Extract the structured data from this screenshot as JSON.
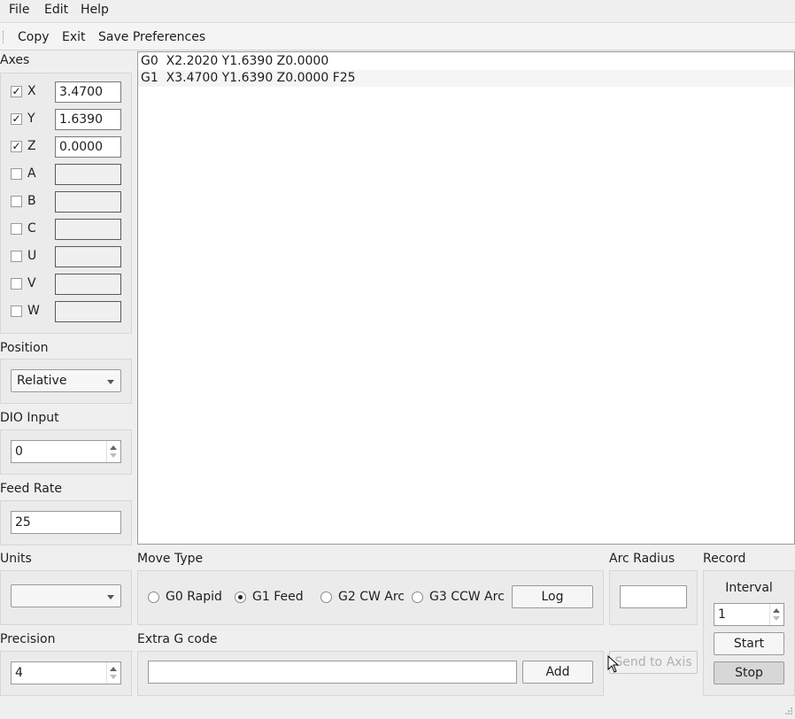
{
  "menu": {
    "file": "File",
    "edit": "Edit",
    "help": "Help"
  },
  "toolbar": {
    "copy": "Copy",
    "exit": "Exit",
    "save_prefs": "Save Preferences"
  },
  "axes": {
    "title": "Axes",
    "items": [
      {
        "label": "X",
        "checked": true,
        "value": "3.4700"
      },
      {
        "label": "Y",
        "checked": true,
        "value": "1.6390"
      },
      {
        "label": "Z",
        "checked": true,
        "value": "0.0000"
      },
      {
        "label": "A",
        "checked": false,
        "value": ""
      },
      {
        "label": "B",
        "checked": false,
        "value": ""
      },
      {
        "label": "C",
        "checked": false,
        "value": ""
      },
      {
        "label": "U",
        "checked": false,
        "value": ""
      },
      {
        "label": "V",
        "checked": false,
        "value": ""
      },
      {
        "label": "W",
        "checked": false,
        "value": ""
      }
    ]
  },
  "position": {
    "title": "Position",
    "selected": "Relative"
  },
  "dio": {
    "title": "DIO  Input",
    "value": "0"
  },
  "feed": {
    "title": "Feed Rate",
    "value": "25"
  },
  "units": {
    "title": "Units",
    "selected": ""
  },
  "precision": {
    "title": "Precision",
    "value": "4"
  },
  "code_lines": [
    "G0  X2.2020 Y1.6390 Z0.0000",
    "G1  X3.4700 Y1.6390 Z0.0000 F25"
  ],
  "move_type": {
    "title": "Move Type",
    "options": [
      "G0 Rapid",
      "G1 Feed",
      "G2 CW Arc",
      "G3 CCW Arc"
    ],
    "selected_index": 1,
    "log_label": "Log"
  },
  "extra": {
    "title": "Extra G code",
    "value": "",
    "add_label": "Add"
  },
  "arc": {
    "title": "Arc Radius",
    "value": "",
    "send_label": "Send to Axis"
  },
  "record": {
    "title": "Record",
    "interval_label": "Interval",
    "interval_value": "1",
    "start_label": "Start",
    "stop_label": "Stop"
  }
}
